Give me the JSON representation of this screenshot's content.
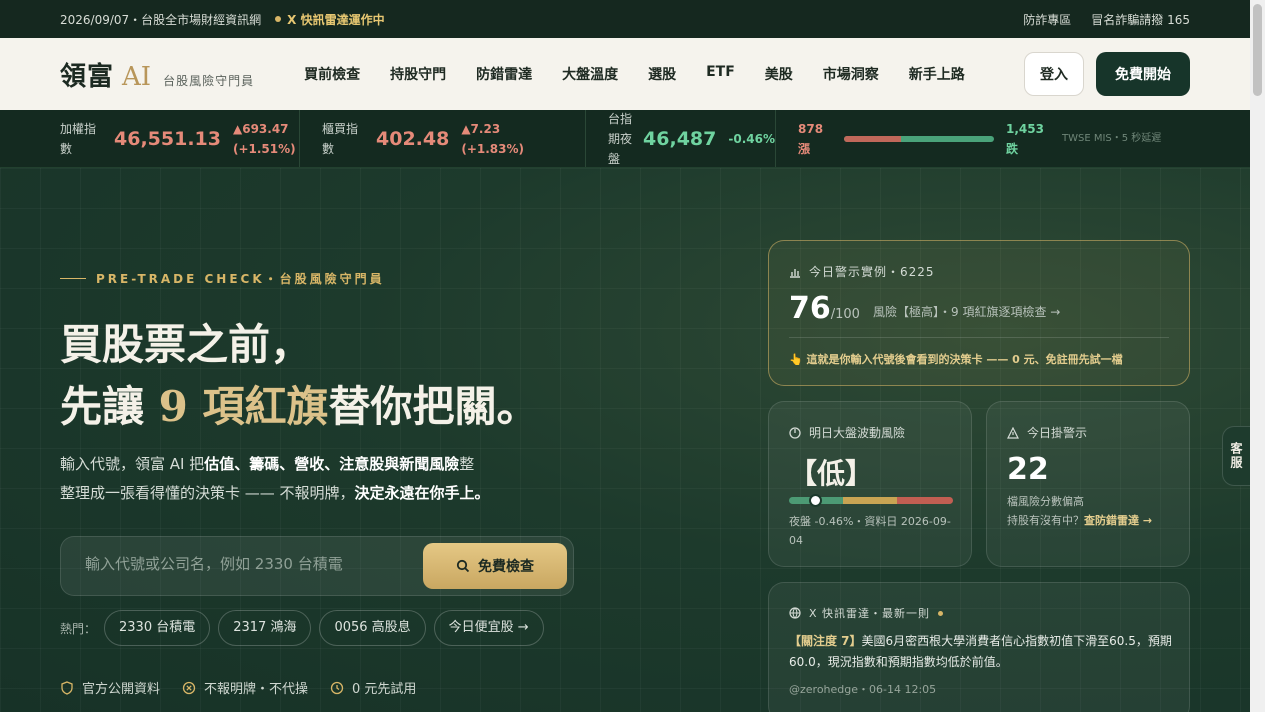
{
  "topbar": {
    "date_line": "2026/09/07・台股全市場財經資訊網",
    "radar_status": "X 快訊雷達運作中",
    "anti_fraud": "防詐專區",
    "fraud_hotline": "冒名詐騙請撥 165"
  },
  "nav": {
    "logo": "領富",
    "logo_ai": "AI",
    "tagline": "台股風險守門員",
    "menu": [
      "買前檢查",
      "持股守門",
      "防錯雷達",
      "大盤溫度",
      "選股",
      "ETF",
      "美股",
      "市場洞察",
      "新手上路"
    ],
    "login": "登入",
    "start_free": "免費開始"
  },
  "ticker": {
    "items": [
      {
        "label": "加權指數",
        "value": "46,551.13",
        "change": "▲693.47",
        "pct": "(+1.51%)"
      },
      {
        "label": "櫃買指數",
        "value": "402.48",
        "change": "▲7.23",
        "pct": "(+1.83%)"
      },
      {
        "label": "台指期夜盤",
        "value": "46,487",
        "change": "-0.46%"
      }
    ],
    "advances": "878",
    "advances_label": "漲",
    "declines": "1,453",
    "declines_label": "跌",
    "advance_fraction": 0.377,
    "source": "TWSE MIS・5 秒延遲",
    "colors": {
      "up": "#e58a79",
      "down": "#6fd3a0"
    }
  },
  "hero": {
    "eyebrow": "PRE-TRADE CHECK・台股風險守門員",
    "title_line1": "買股票之前，",
    "title_pre": "先讓 ",
    "title_highlight": "9 項紅旗",
    "title_post": "替你把關。",
    "desc_1": "輸入代號，領富 AI 把",
    "desc_bold_1": "估值、籌碼、營收、注意股與新聞風險",
    "desc_2": "整理成一張看得懂的決策卡 —— 不報明牌，",
    "desc_bold_2": "決定永遠在你手上。",
    "search_placeholder": "輸入代號或公司名，例如 2330 台積電",
    "search_button": "免費檢查",
    "hot_label": "熱門：",
    "hot_chips": [
      "2330 台積電",
      "2317 鴻海",
      "0056 高股息",
      "今日便宜股 →"
    ],
    "features": [
      "官方公開資料",
      "不報明牌・不代操",
      "0 元先試用"
    ]
  },
  "cards": {
    "example": {
      "head": "今日警示實例・6225",
      "score": "76",
      "score_max": "/100",
      "risk": "風險【極高】・9 項紅旗逐項檢查 →",
      "note": "👆 這就是你輸入代號後會看到的決策卡 —— 0 元、免註冊先試一檔"
    },
    "market": {
      "head": "明日大盤波動風險",
      "level": "【低】",
      "gauge_fraction": 0.16,
      "sub": "夜盤 -0.46%・資料日 2026-09-04"
    },
    "alerts": {
      "head": "今日掛警示",
      "count": "22",
      "sub1": "檔風險分數偏高",
      "sub2": "持股有沒有中？",
      "sub_link": "查防錯雷達 →"
    },
    "news": {
      "head": "X 快訊雷達・最新一則",
      "tag": "【關注度 7】",
      "text": "美國6月密西根大學消費者信心指數初值下滑至60.5，預期60.0，現況指數和預期指數均低於前值。",
      "meta": "@zerohedge・06-14 12:05"
    }
  },
  "service": "客服"
}
